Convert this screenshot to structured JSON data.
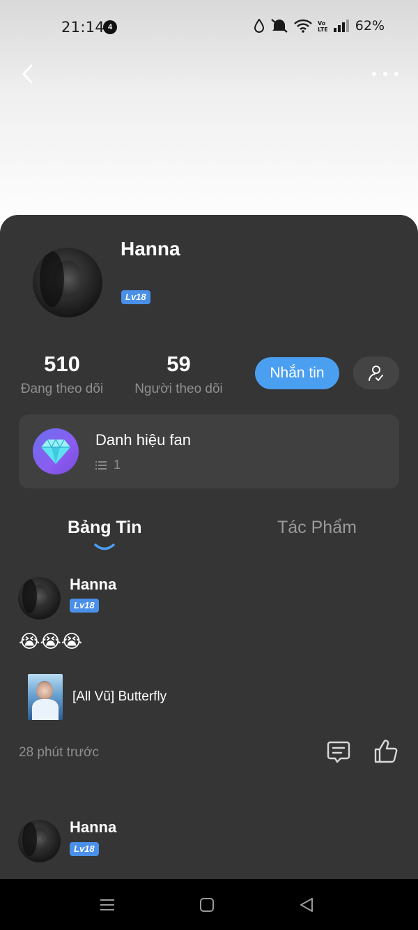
{
  "status_bar": {
    "time": "21:14",
    "notification_count": "4",
    "battery": "62%"
  },
  "header": {
    "back_icon": "chevron-left-icon",
    "more_icon": "more-horizontal-icon"
  },
  "profile": {
    "name": "Hanna",
    "level": "Lv18",
    "stats": [
      {
        "value": "510",
        "label": "Đang theo dõi"
      },
      {
        "value": "59",
        "label": "Người theo dõi"
      }
    ],
    "message_button": "Nhắn tin",
    "follow_icon": "user-check-icon"
  },
  "fan_title": {
    "label": "Danh hiệu fan",
    "count": "1",
    "icon": "diamond-icon"
  },
  "tabs": [
    {
      "label": "Bảng Tin",
      "active": true
    },
    {
      "label": "Tác Phẩm",
      "active": false
    }
  ],
  "posts": [
    {
      "author": "Hanna",
      "level": "Lv18",
      "text": "😭😭😭",
      "book_title": "[All Vũ] Butterfly",
      "time": "28 phút trước"
    },
    {
      "author": "Hanna",
      "level": "Lv18"
    }
  ],
  "colors": {
    "sheet_bg": "#353535",
    "accent_blue": "#4a9ff0",
    "level_badge": "#4a8fe8",
    "card_bg": "#404040",
    "nav_bar": "#000000"
  }
}
